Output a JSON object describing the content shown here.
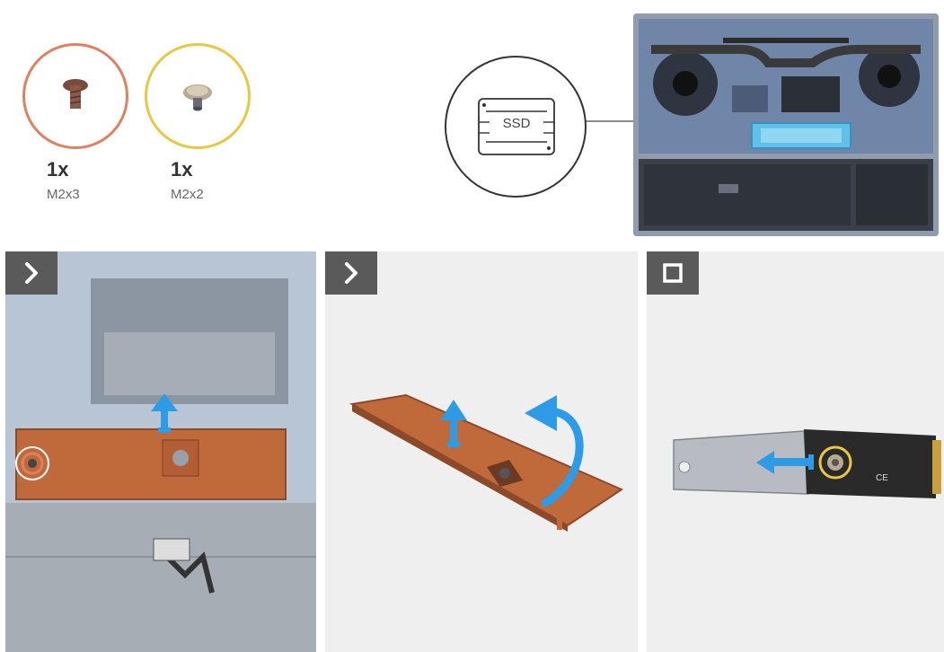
{
  "screws": [
    {
      "quantity": "1x",
      "size": "M2x3",
      "ring_color": "#e08060"
    },
    {
      "quantity": "1x",
      "size": "M2x2",
      "ring_color": "#e8c840"
    }
  ],
  "callout": {
    "label": "SSD"
  },
  "steps": [
    {
      "icon": "chevron-right-icon"
    },
    {
      "icon": "chevron-right-icon"
    },
    {
      "icon": "square-stop-icon"
    }
  ],
  "colors": {
    "arrow": "#2e9be6",
    "copper": "#c06a3c",
    "highlight": "#5fc1e8",
    "badge": "#5a5a5a"
  }
}
